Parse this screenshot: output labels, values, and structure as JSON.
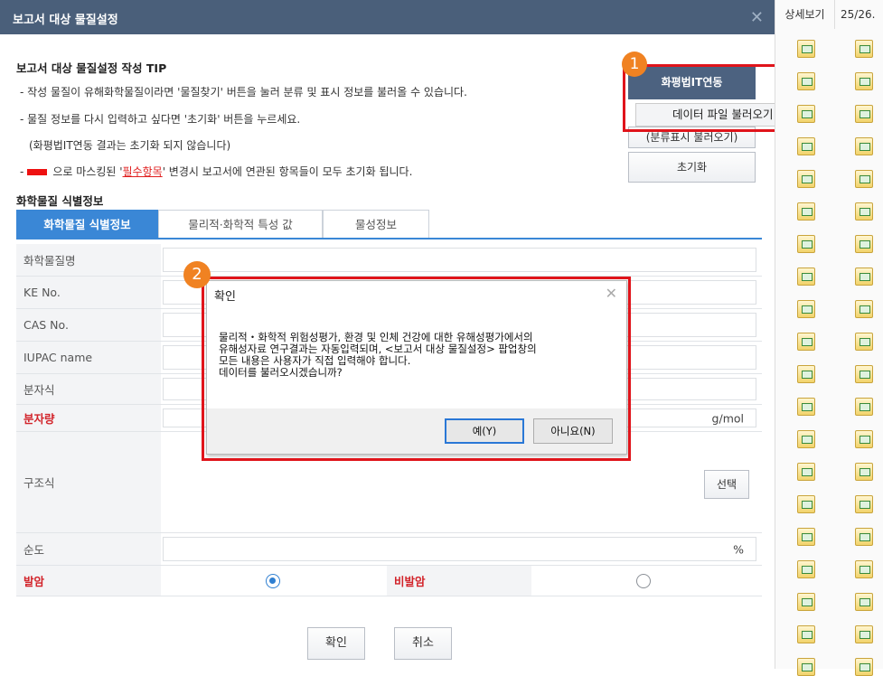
{
  "dialog": {
    "title": "보고서 대상 물질설정",
    "close_icon": "close-icon"
  },
  "tips": {
    "title": "보고서 대상 물질설정 작성 TIP",
    "line1": "- 작성 물질이 유해화학물질이라면 '물질찾기' 버튼을 눌러 분류 및 표시 정보를 불러올 수 있습니다.",
    "line2": "- 물질 정보를 다시 입력하고 싶다면 '초기화' 버튼을 누르세요.",
    "line3": "(화평법IT연동 결과는 초기화 되지 않습니다)",
    "line4_prefix": "-",
    "line4_mid": "으로 마스킹된 '",
    "line4_required": "필수항목",
    "line4_suffix": "' 변경시 보고서에 연관된 항목들이 모두 초기화 됩니다."
  },
  "buttons": {
    "chem_it": "화평법IT연동",
    "datafile": "데이터 파일 불러오기",
    "classify": "(분류표시 불러오기)",
    "reset": "초기화"
  },
  "markers": {
    "one": "1",
    "two": "2"
  },
  "section_title": "화학물질 식별정보",
  "tabs": [
    "화학물질 식별정보",
    "물리적·화학적 특성 값",
    "물성정보"
  ],
  "form": {
    "name_label": "화학물질명",
    "ke_label": "KE No.",
    "cas_label": "CAS No.",
    "iupac_label": "IUPAC name",
    "formula_label": "분자식",
    "weight_label": "분자량",
    "weight_unit": "g/mol",
    "structure_label": "구조식",
    "structure_button": "선택",
    "purity_label": "순도",
    "purity_unit": "%",
    "carcinogen_label": "발암",
    "non_carcinogen_label": "비발암"
  },
  "footer": {
    "ok": "확인",
    "cancel": "취소"
  },
  "confirm": {
    "title": "확인",
    "msg1": "물리적・화학적 위험성평가, 환경 및 인체 건강에 대한 유해성평가에서의",
    "msg2": "유해성자료 연구결과는 자동입력되며, <보고서 대상 물질설정> 팝업창의",
    "msg3": "모든 내용은 사용자가 직접 입력해야 합니다.",
    "msg4": "데이터를 불러오시겠습니까?",
    "yes": "예(Y)",
    "no": "아니요(N)"
  },
  "right_panel": {
    "col1": "상세보기",
    "col2": "25/26."
  },
  "colors": {
    "titlebar": "#4a5f7a",
    "tab_active": "#3a87d6",
    "highlight": "#e0141b",
    "marker": "#f08222",
    "required": "#d2232a"
  }
}
